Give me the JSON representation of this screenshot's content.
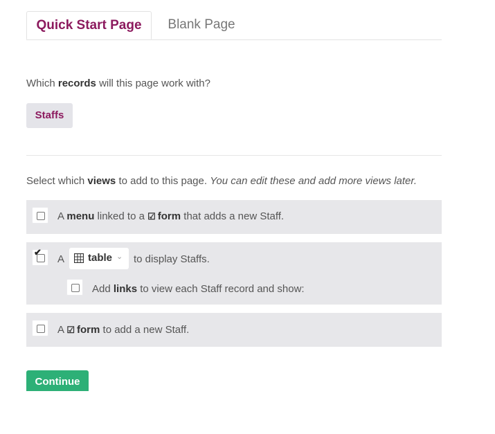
{
  "tabs": {
    "active_label": "Quick Start Page",
    "inactive_label": "Blank Page"
  },
  "records_question": {
    "prefix": "Which",
    "bold": "records",
    "suffix": "will this page work with?"
  },
  "record_button": "Staffs",
  "views_question": {
    "prefix": "Select which",
    "bold": "views",
    "middle": "to add to this page.",
    "italic": "You can edit these and add more views later."
  },
  "options": {
    "menu": {
      "checked": false,
      "a": "A",
      "menu_bold": "menu",
      "linked": "linked to a",
      "form_bold": "form",
      "suffix": "that adds a new Staff."
    },
    "table": {
      "checked": true,
      "a": "A",
      "select_value": "table",
      "suffix": "to display Staffs.",
      "sub_checked": false,
      "sub_prefix": "Add",
      "sub_bold": "links",
      "sub_suffix": "to view each Staff record and show:"
    },
    "form": {
      "checked": false,
      "a": "A",
      "form_bold": "form",
      "suffix": "to add a new Staff."
    }
  },
  "icons": {
    "check_form_icon": "checkbox-icon",
    "table_icon": "grid-icon",
    "chevron_icon": "chevron-down-icon"
  },
  "continue_label": "Continue",
  "colors": {
    "accent": "#8c1a5e",
    "continue_bg": "#2db077",
    "panel_bg": "#e7e7ea"
  }
}
